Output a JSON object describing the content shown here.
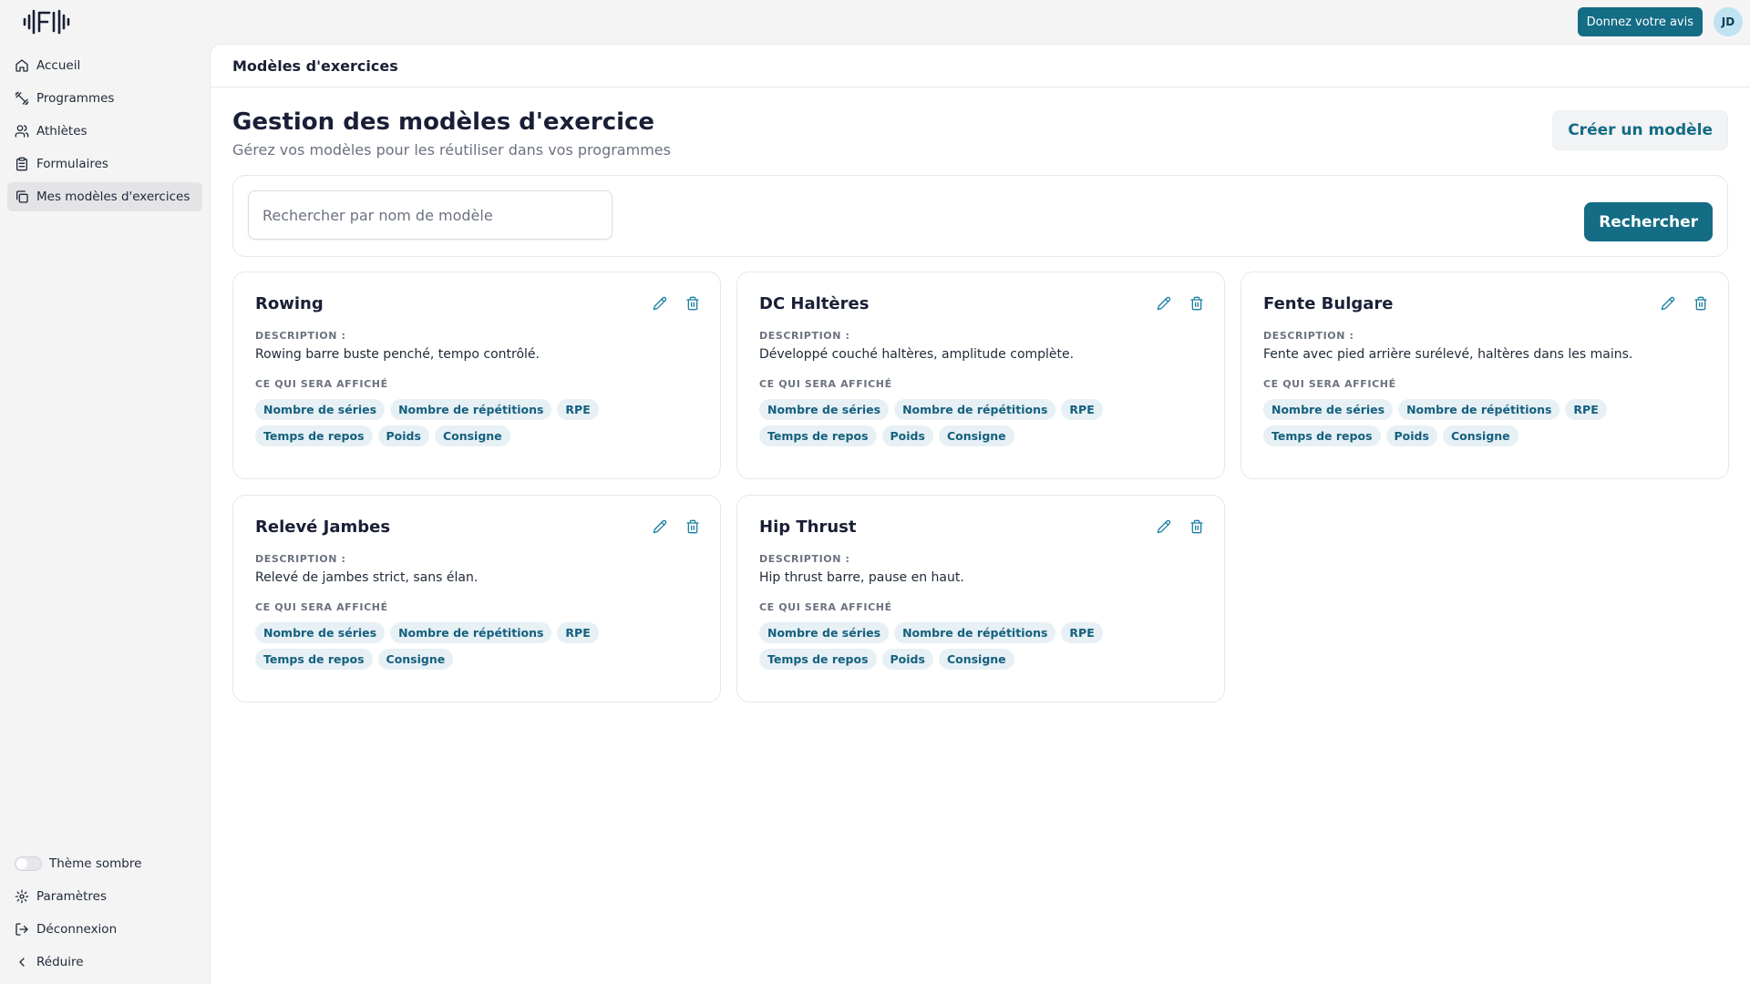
{
  "header": {
    "feedback_label": "Donnez votre avis",
    "avatar_initials": "JD"
  },
  "sidebar": {
    "items": [
      {
        "label": "Accueil",
        "icon": "home-icon"
      },
      {
        "label": "Programmes",
        "icon": "dumbbell-icon"
      },
      {
        "label": "Athlètes",
        "icon": "users-icon"
      },
      {
        "label": "Formulaires",
        "icon": "clipboard-icon"
      },
      {
        "label": "Mes modèles d'exercices",
        "icon": "copy-icon",
        "active": true
      }
    ],
    "bottom": {
      "theme_label": "Thème sombre",
      "settings_label": "Paramètres",
      "logout_label": "Déconnexion",
      "collapse_label": "Réduire"
    }
  },
  "main": {
    "breadcrumb": "Modèles d'exercices",
    "title": "Gestion des modèles d'exercice",
    "subtitle": "Gérez vos modèles pour les réutiliser dans vos programmes",
    "create_label": "Créer un modèle",
    "search": {
      "placeholder": "Rechercher par nom de modèle",
      "button_label": "Rechercher"
    },
    "description_label": "DESCRIPTION :",
    "display_label": "CE QUI SERA AFFICHÉ",
    "cards": [
      {
        "name": "Rowing",
        "description": "Rowing barre buste penché, tempo contrôlé.",
        "tags": [
          "Nombre de séries",
          "Nombre de répétitions",
          "RPE",
          "Temps de repos",
          "Poids",
          "Consigne"
        ]
      },
      {
        "name": "DC Haltères",
        "description": "Développé couché haltères, amplitude complète.",
        "tags": [
          "Nombre de séries",
          "Nombre de répétitions",
          "RPE",
          "Temps de repos",
          "Poids",
          "Consigne"
        ]
      },
      {
        "name": "Fente Bulgare",
        "description": "Fente avec pied arrière surélevé, haltères dans les mains.",
        "tags": [
          "Nombre de séries",
          "Nombre de répétitions",
          "RPE",
          "Temps de repos",
          "Poids",
          "Consigne"
        ]
      },
      {
        "name": "Relevé Jambes",
        "description": "Relevé de jambes strict, sans élan.",
        "tags": [
          "Nombre de séries",
          "Nombre de répétitions",
          "RPE",
          "Temps de repos",
          "Consigne"
        ]
      },
      {
        "name": "Hip Thrust",
        "description": "Hip thrust barre, pause en haut.",
        "tags": [
          "Nombre de séries",
          "Nombre de répétitions",
          "RPE",
          "Temps de repos",
          "Poids",
          "Consigne"
        ]
      }
    ]
  },
  "colors": {
    "accent": "#146c85",
    "tag_bg": "#e6f0f5",
    "tag_text": "#15607d"
  }
}
